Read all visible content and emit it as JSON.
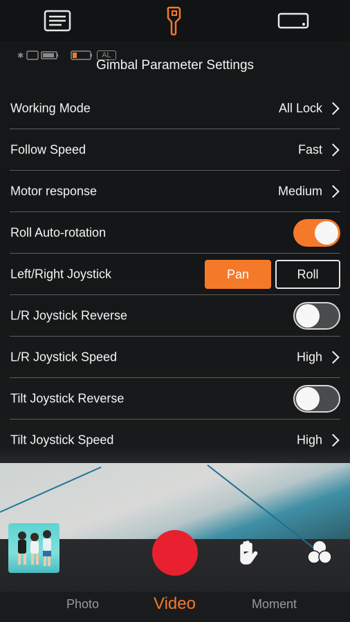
{
  "panel": {
    "title": "Gimbal Parameter Settings"
  },
  "rows": [
    {
      "label": "Working Mode",
      "value": "All Lock",
      "control": "chevron"
    },
    {
      "label": "Follow Speed",
      "value": "Fast",
      "control": "chevron"
    },
    {
      "label": "Motor response",
      "value": "Medium",
      "control": "chevron"
    },
    {
      "label": "Roll Auto-rotation",
      "control": "toggle",
      "on": true
    },
    {
      "label": "Left/Right Joystick",
      "control": "segmented",
      "options": [
        "Pan",
        "Roll"
      ],
      "selected": "Pan"
    },
    {
      "label": "L/R Joystick Reverse",
      "control": "toggle",
      "on": false
    },
    {
      "label": "L/R Joystick Speed",
      "value": "High",
      "control": "chevron"
    },
    {
      "label": "Tilt Joystick Reverse",
      "control": "toggle",
      "on": false
    },
    {
      "label": "Tilt Joystick Speed",
      "value": "High",
      "control": "chevron"
    }
  ],
  "status": {
    "ae_badge": "AL"
  },
  "modes": {
    "photo": "Photo",
    "video": "Video",
    "moment": "Moment",
    "active": "Video"
  },
  "colors": {
    "accent": "#f47a2a",
    "record": "#e8202f"
  },
  "icons": {
    "left_toolbar": "menu-list-icon",
    "center_toolbar": "gimbal-icon",
    "right_toolbar": "device-landscape-icon",
    "gesture": "hand-icon",
    "filter": "color-filter-icon"
  }
}
